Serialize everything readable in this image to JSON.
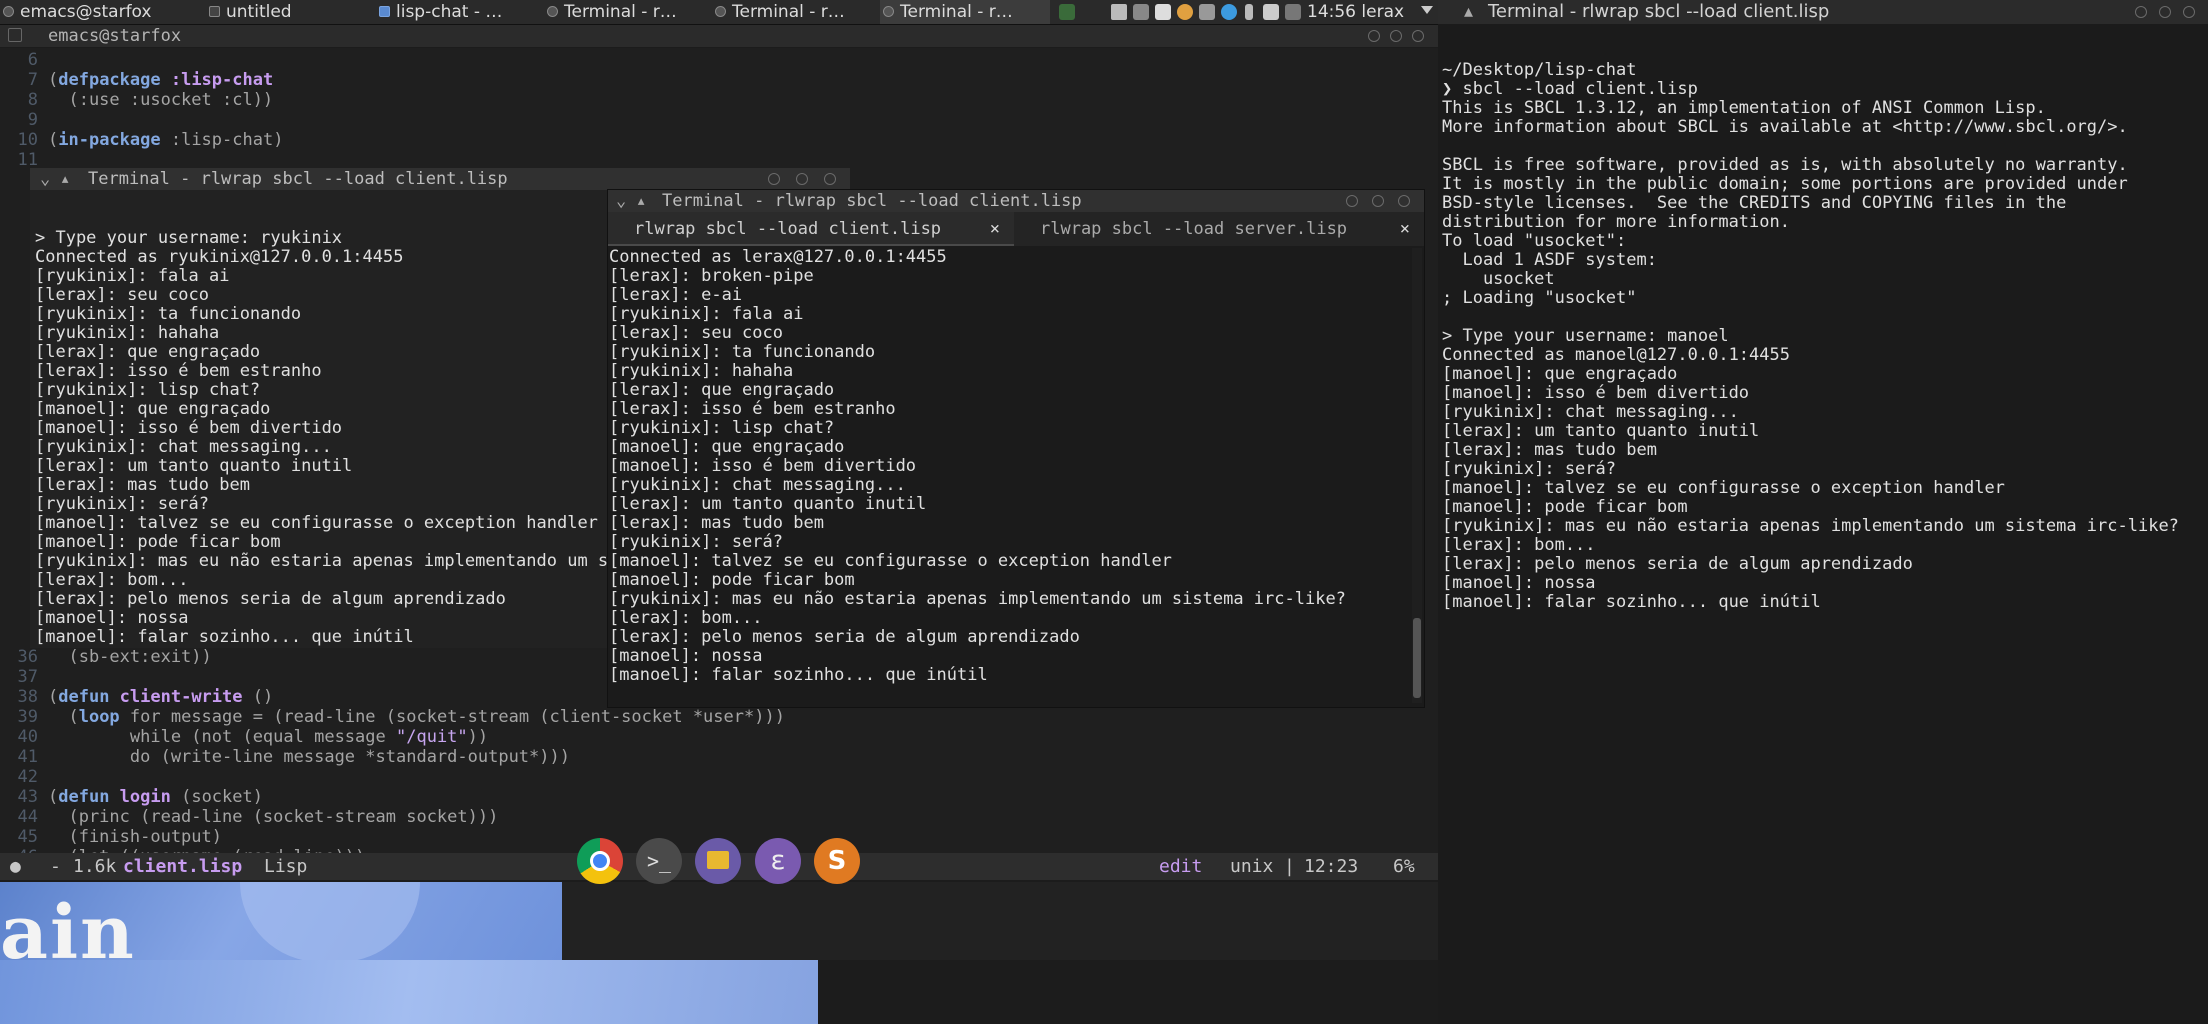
{
  "taskbar": {
    "tasks": [
      "emacs@starfox",
      "untitled",
      "lisp-chat - …",
      "Terminal - r…",
      "Terminal - r…",
      "Terminal - r…"
    ],
    "clock": "14:56",
    "user": "lerax"
  },
  "emacs": {
    "title": "emacs@starfox",
    "code_lines": [
      {
        "n": "6",
        "parts": [
          {
            "t": "",
            "c": ""
          }
        ]
      },
      {
        "n": "7",
        "parts": [
          {
            "t": "(",
            "c": "par"
          },
          {
            "t": "defpackage",
            "c": "kw"
          },
          {
            "t": " :lisp-chat",
            "c": "kw2"
          }
        ]
      },
      {
        "n": "8",
        "parts": [
          {
            "t": "  (:use :usocket :cl))",
            "c": "par"
          }
        ]
      },
      {
        "n": "9",
        "parts": [
          {
            "t": "",
            "c": ""
          }
        ]
      },
      {
        "n": "10",
        "parts": [
          {
            "t": "(",
            "c": "par"
          },
          {
            "t": "in-package",
            "c": "kw"
          },
          {
            "t": " :lisp-chat)",
            "c": "par"
          }
        ]
      },
      {
        "n": "11",
        "parts": [
          {
            "t": "",
            "c": ""
          }
        ]
      }
    ],
    "code_lines_bottom": [
      {
        "n": "36",
        "parts": [
          {
            "t": "  (sb-ext:exit))",
            "c": "par"
          }
        ]
      },
      {
        "n": "37",
        "parts": [
          {
            "t": "",
            "c": ""
          }
        ]
      },
      {
        "n": "38",
        "parts": [
          {
            "t": "(",
            "c": "par"
          },
          {
            "t": "defun",
            "c": "kw"
          },
          {
            "t": " client-write",
            "c": "kw2"
          },
          {
            "t": " ()",
            "c": "par"
          }
        ]
      },
      {
        "n": "39",
        "parts": [
          {
            "t": "  (",
            "c": "par"
          },
          {
            "t": "loop",
            "c": "kw"
          },
          {
            "t": " for message = (read-line (socket-stream (client-socket *user*)))",
            "c": "par"
          }
        ]
      },
      {
        "n": "40",
        "parts": [
          {
            "t": "        while (not (equal message ",
            "c": "par"
          },
          {
            "t": "\"/quit\"",
            "c": "str"
          },
          {
            "t": "))",
            "c": "par"
          }
        ]
      },
      {
        "n": "41",
        "parts": [
          {
            "t": "        do (write-line message *standard-output*)))",
            "c": "par"
          }
        ]
      },
      {
        "n": "42",
        "parts": [
          {
            "t": "",
            "c": ""
          }
        ]
      },
      {
        "n": "43",
        "parts": [
          {
            "t": "(",
            "c": "par"
          },
          {
            "t": "defun",
            "c": "kw"
          },
          {
            "t": " login",
            "c": "kw2"
          },
          {
            "t": " (socket)",
            "c": "par"
          }
        ]
      },
      {
        "n": "44",
        "parts": [
          {
            "t": "  (princ (read-line (socket-stream socket)))",
            "c": "par"
          }
        ]
      },
      {
        "n": "45",
        "parts": [
          {
            "t": "  (finish-output)",
            "c": "par"
          }
        ]
      },
      {
        "n": "46",
        "parts": [
          {
            "t": "  (let ((username (read-line)))",
            "c": "par"
          }
        ]
      }
    ],
    "modeline": {
      "size": "1.6k",
      "file": "client.lisp",
      "mode": "Lisp",
      "state": "edit",
      "eol": "unix",
      "position": "12:23",
      "percent": "6%"
    }
  },
  "term_a": {
    "title": "Terminal - rlwrap sbcl --load client.lisp",
    "lines": [
      "",
      "> Type your username: ryukinix",
      "Connected as ryukinix@127.0.0.1:4455",
      "[ryukinix]: fala ai",
      "[lerax]: seu coco",
      "[ryukinix]: ta funcionando",
      "[ryukinix]: hahaha",
      "[lerax]: que engraçado",
      "[lerax]: isso é bem estranho",
      "[ryukinix]: lisp chat?",
      "[manoel]: que engraçado",
      "[manoel]: isso é bem divertido",
      "[ryukinix]: chat messaging...",
      "[lerax]: um tanto quanto inutil",
      "[lerax]: mas tudo bem",
      "[ryukinix]: será?",
      "[manoel]: talvez se eu configurasse o exception handler",
      "[manoel]: pode ficar bom",
      "[ryukinix]: mas eu não estaria apenas implementando um si",
      "[lerax]: bom...",
      "[lerax]: pelo menos seria de algum aprendizado",
      "[manoel]: nossa",
      "[manoel]: falar sozinho... que inútil"
    ]
  },
  "term_b": {
    "title": "Terminal - rlwrap sbcl --load client.lisp",
    "tabs": [
      "rlwrap sbcl --load client.lisp",
      "rlwrap sbcl --load server.lisp"
    ],
    "tab_close": "×",
    "lines": [
      "Connected as lerax@127.0.0.1:4455",
      "[lerax]: broken-pipe",
      "[lerax]: e-ai",
      "[ryukinix]: fala ai",
      "[lerax]: seu coco",
      "[ryukinix]: ta funcionando",
      "[ryukinix]: hahaha",
      "[lerax]: que engraçado",
      "[lerax]: isso é bem estranho",
      "[ryukinix]: lisp chat?",
      "[manoel]: que engraçado",
      "[manoel]: isso é bem divertido",
      "[ryukinix]: chat messaging...",
      "[lerax]: um tanto quanto inutil",
      "[lerax]: mas tudo bem",
      "[ryukinix]: será?",
      "[manoel]: talvez se eu configurasse o exception handler",
      "[manoel]: pode ficar bom",
      "[ryukinix]: mas eu não estaria apenas implementando um sistema irc-like?",
      "[lerax]: bom...",
      "[lerax]: pelo menos seria de algum aprendizado",
      "[manoel]: nossa",
      "[manoel]: falar sozinho... que inútil"
    ]
  },
  "term_r": {
    "title": "Terminal - rlwrap sbcl --load client.lisp",
    "lines": [
      "~/Desktop/lisp-chat",
      "❯ sbcl --load client.lisp",
      "This is SBCL 1.3.12, an implementation of ANSI Common Lisp.",
      "More information about SBCL is available at <http://www.sbcl.org/>.",
      "",
      "SBCL is free software, provided as is, with absolutely no warranty.",
      "It is mostly in the public domain; some portions are provided under",
      "BSD-style licenses.  See the CREDITS and COPYING files in the",
      "distribution for more information.",
      "To load \"usocket\":",
      "  Load 1 ASDF system:",
      "    usocket",
      "; Loading \"usocket\"",
      "",
      "> Type your username: manoel",
      "Connected as manoel@127.0.0.1:4455",
      "[manoel]: que engraçado",
      "[manoel]: isso é bem divertido",
      "[ryukinix]: chat messaging...",
      "[lerax]: um tanto quanto inutil",
      "[lerax]: mas tudo bem",
      "[ryukinix]: será?",
      "[manoel]: talvez se eu configurasse o exception handler",
      "[manoel]: pode ficar bom",
      "[ryukinix]: mas eu não estaria apenas implementando um sistema irc-like?",
      "[lerax]: bom...",
      "[lerax]: pelo menos seria de algum aprendizado",
      "[manoel]: nossa",
      "[manoel]: falar sozinho... que inútil"
    ]
  },
  "wallpaper_text": "ain",
  "dock": {
    "apps": [
      "chrome-icon",
      "terminal-icon",
      "archive-icon",
      "emacs-icon",
      "sublime-icon"
    ],
    "sublime_letter": "S"
  },
  "colors": {
    "background": "#1c1c1c",
    "terminal_bg": "#1b1b1b",
    "keyword": "#83a8e0",
    "symbol": "#c79cf0",
    "string": "#c7a6f0",
    "wallpaper_blue": "#7195dc"
  }
}
